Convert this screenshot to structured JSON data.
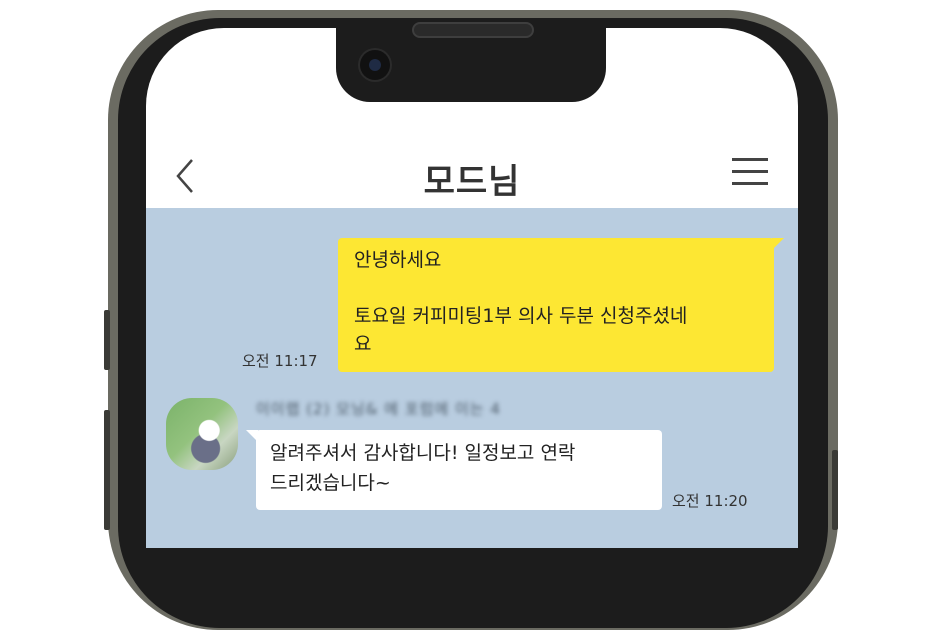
{
  "header": {
    "title": "모드님",
    "back_icon": "chevron-left-icon",
    "menu_icon": "hamburger-menu-icon"
  },
  "messages": [
    {
      "direction": "outgoing",
      "lines": [
        "안녕하세요",
        "",
        "토요일 커피미팅1부 의사 두분 신청주셨네",
        "요"
      ],
      "time": "오전 11:17",
      "bubble_color": "#fde733"
    },
    {
      "direction": "incoming",
      "sender": "이이랩 (2) 모닝& 에 포럼에 이는 4",
      "lines": [
        "알려주셔서 감사합니다! 일정보고 연락",
        "드리겠습니다~"
      ],
      "time": "오전 11:20",
      "bubble_color": "#ffffff"
    }
  ],
  "colors": {
    "chat_background": "#b9cde0",
    "frame": "#6b6b62"
  }
}
